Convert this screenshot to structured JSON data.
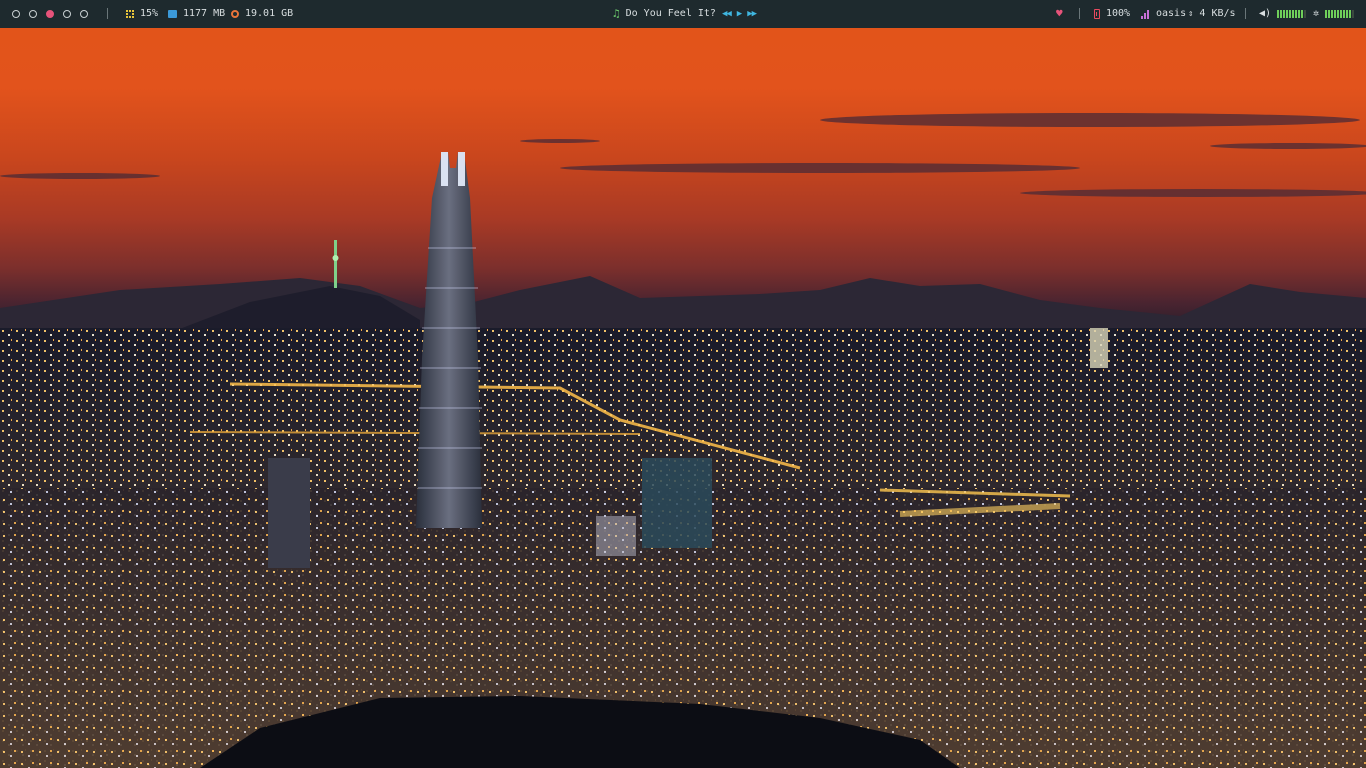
{
  "workspaces": [
    {
      "id": 1,
      "active": false
    },
    {
      "id": 2,
      "active": false
    },
    {
      "id": 3,
      "active": true
    },
    {
      "id": 4,
      "active": false
    },
    {
      "id": 5,
      "active": false
    }
  ],
  "system": {
    "cpu_icon": "cpu-icon",
    "cpu": "15%",
    "memory_icon": "memory-icon",
    "memory": "1177 MB",
    "disk_icon": "disk-icon",
    "disk": "19.01 GB"
  },
  "music": {
    "icon": "music-note-icon",
    "title": "Do You Feel It?",
    "controls": [
      "previous-icon",
      "play-icon",
      "next-icon"
    ]
  },
  "status": {
    "heart_icon": "heart-icon",
    "battery_icon": "battery-icon",
    "battery": "100%",
    "wifi_icon": "wifi-icon",
    "network": "oasis",
    "updown_icon": "updown-arrows-icon",
    "speed": "4 KB/s",
    "volume_icon": "volume-icon",
    "volume_level": 0.9,
    "brightness_icon": "brightness-icon",
    "brightness_level": 0.9
  },
  "colors": {
    "bar_bg": "#1e2a2e",
    "accent_pink": "#e7537a",
    "accent_blue": "#3fb6e0",
    "accent_green": "#6fcf5a"
  },
  "wallpaper": {
    "description_icon": "city-skyline-wallpaper"
  }
}
